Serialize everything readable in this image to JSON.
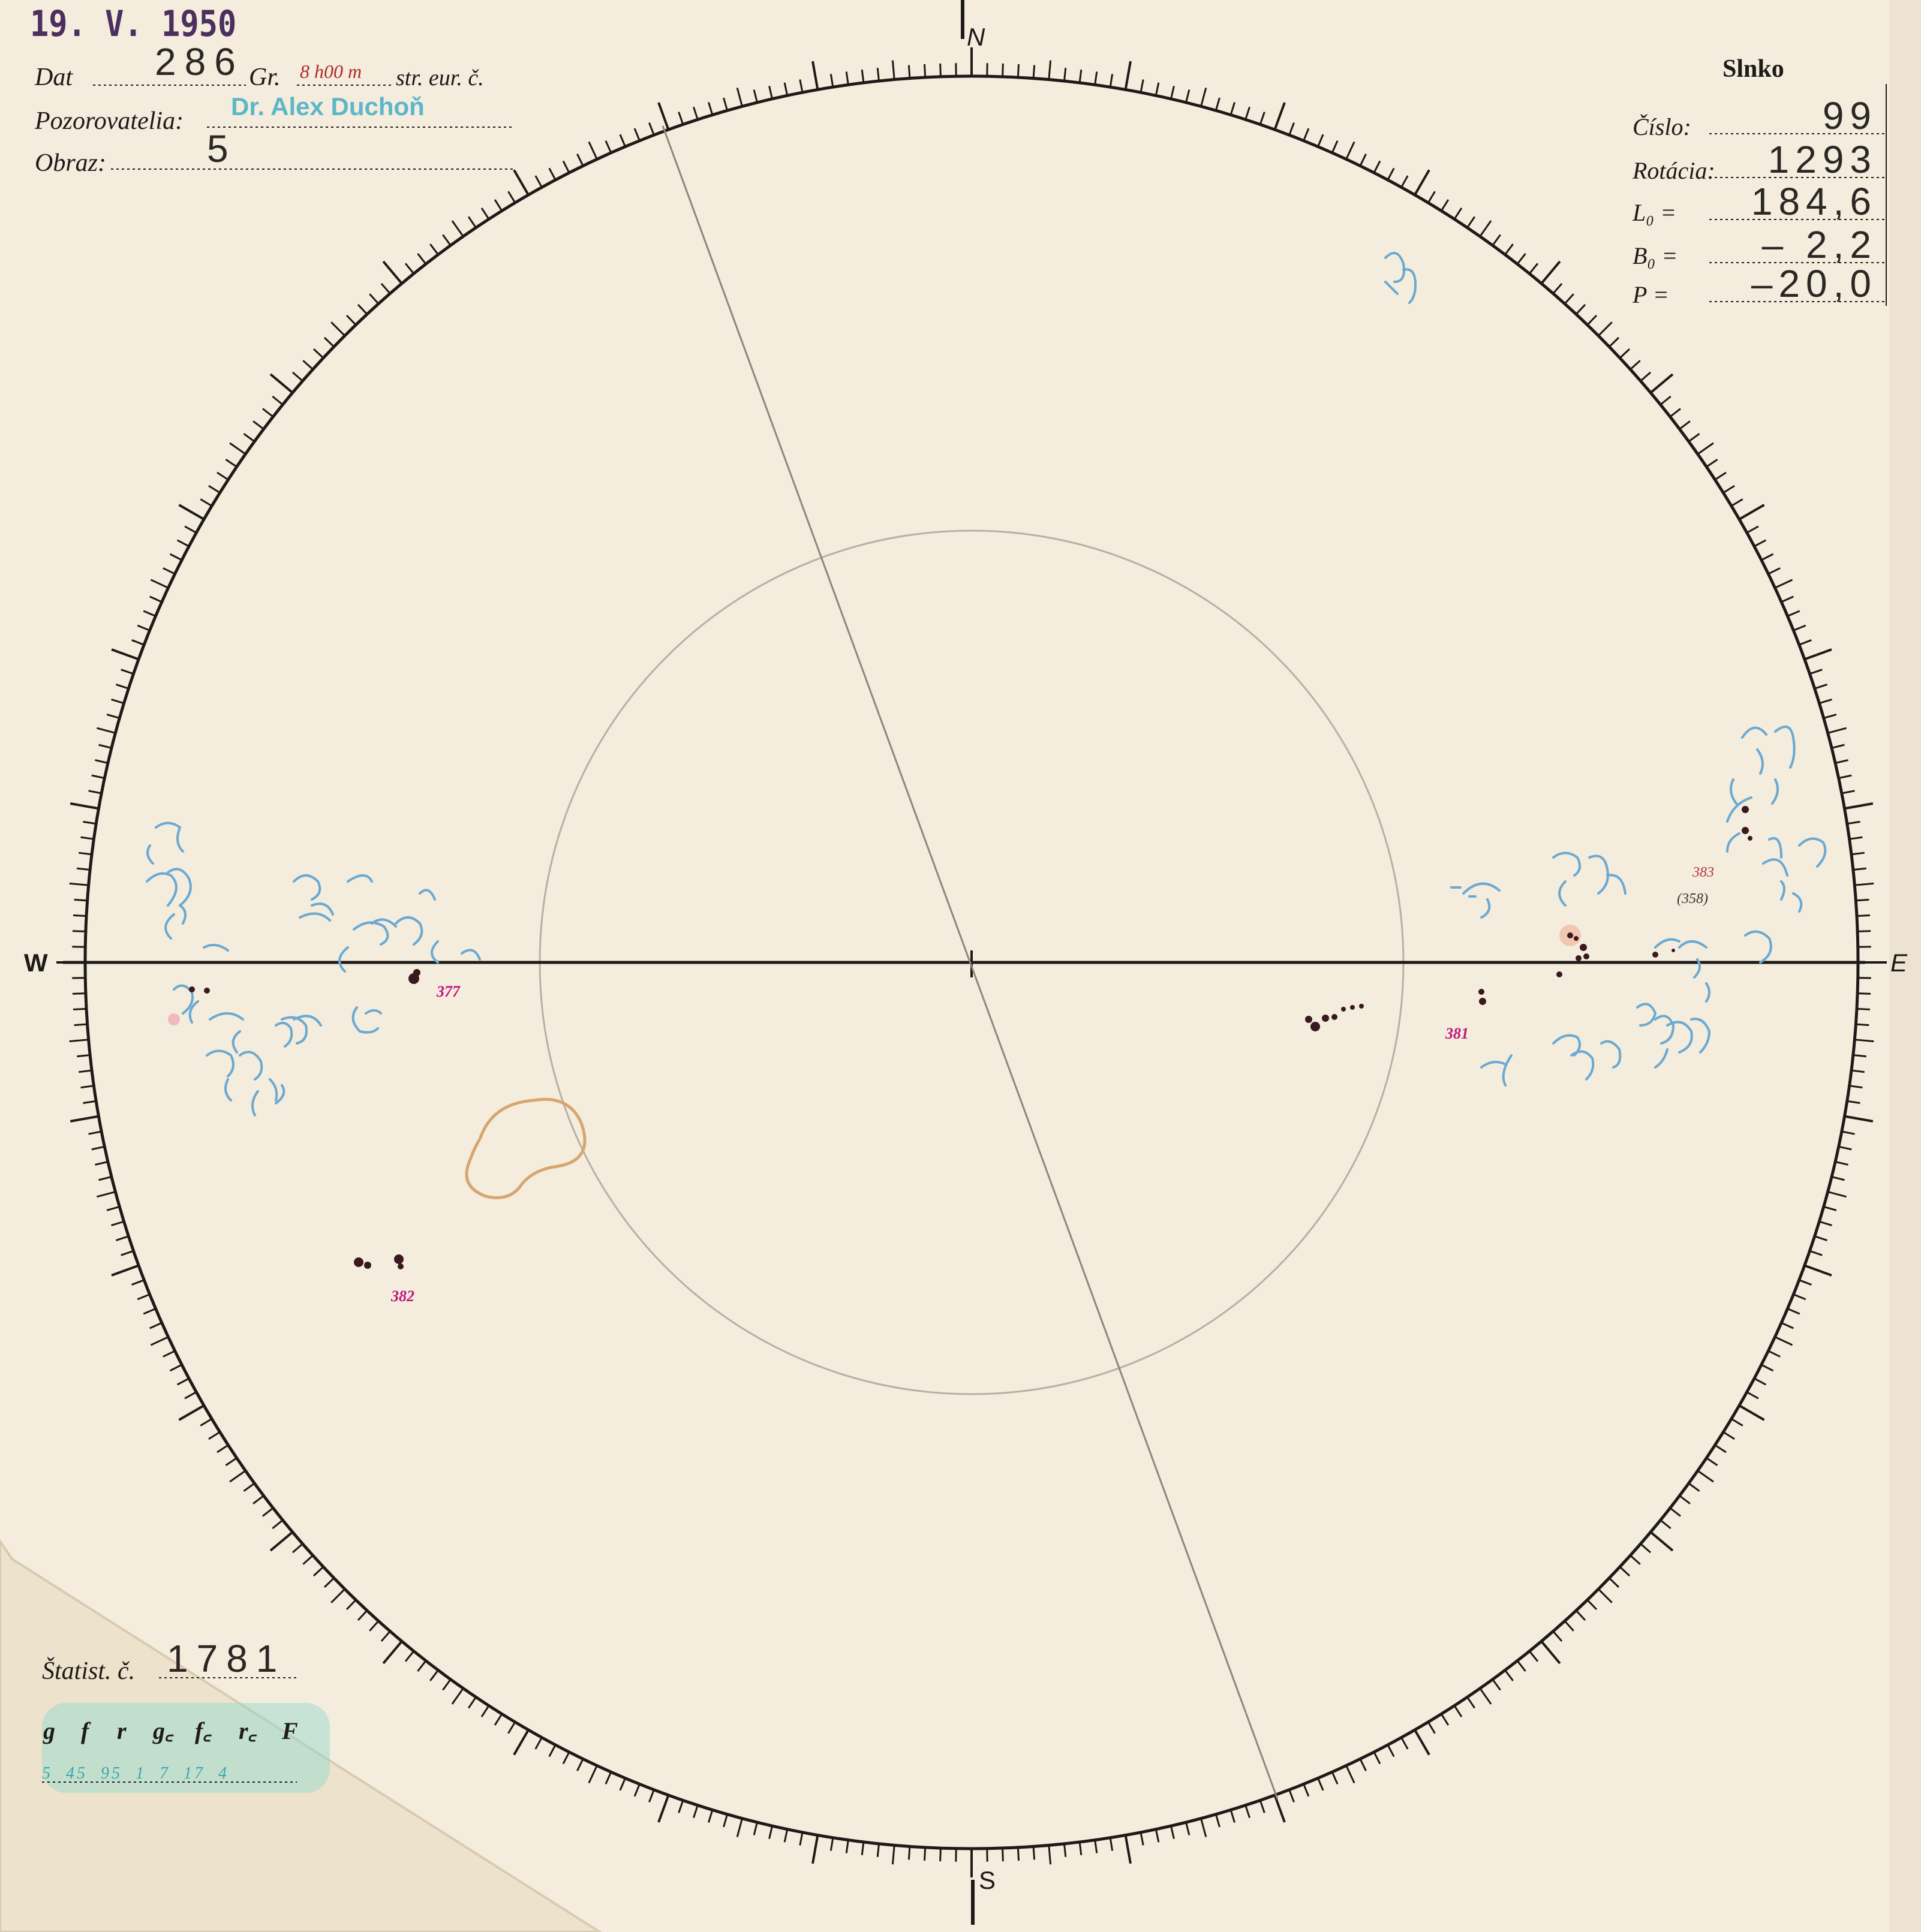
{
  "stamp_date": "19. V. 1950",
  "header_left": {
    "dat_label": "Dat",
    "dat_value": "286",
    "gr_label": "Gr.",
    "time_value": "8 h00 m",
    "time_suffix": "str. eur. č.",
    "observers_label": "Pozorovatelia:",
    "observers_value": "Dr. Alex Duchoň",
    "image_label": "Obraz:",
    "image_value": "5"
  },
  "header_right": {
    "title": "Slnko",
    "fields": [
      {
        "label": "Číslo:",
        "value": "99"
      },
      {
        "label": "Rotácia:",
        "value": "1293"
      },
      {
        "label": "L₀ =",
        "value": "184,6"
      },
      {
        "label": "B₀ =",
        "value": "– 2,2"
      },
      {
        "label": "P =",
        "value": "–20,0"
      }
    ]
  },
  "compass": {
    "north": "N",
    "south": "S",
    "east": "E",
    "west": "W"
  },
  "statistics": {
    "label": "Štatist. č.",
    "number": "1781",
    "headers": [
      "g",
      "f",
      "r",
      "g꜀",
      "f꜀",
      "r꜀",
      "F"
    ],
    "values": "5  45  95  1  7  17  4"
  },
  "sunspot_groups": [
    {
      "id": "377"
    },
    {
      "id": "382"
    },
    {
      "id": "381"
    },
    {
      "id": "383"
    },
    {
      "id": "(358)"
    }
  ],
  "colors": {
    "paper": "#f4ecdd",
    "ink": "#1d1a17",
    "stamp": "#4b2f5e",
    "observer_stamp": "#5cb7c8",
    "facula_blue": "#6aa9d2",
    "group_label": "#c0157a",
    "spot": "#3a1820"
  }
}
